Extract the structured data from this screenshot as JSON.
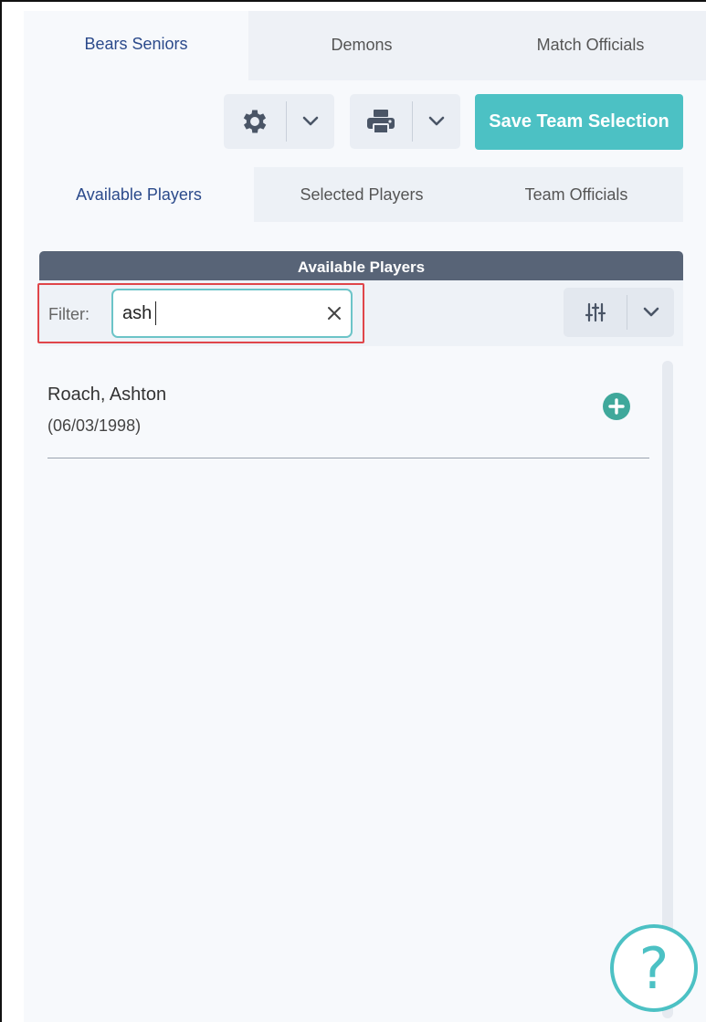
{
  "team_tabs": [
    {
      "label": "Bears Seniors",
      "active": true
    },
    {
      "label": "Demons",
      "active": false
    },
    {
      "label": "Match Officials",
      "active": false
    }
  ],
  "toolbar": {
    "settings_icon": "gear-icon",
    "print_icon": "printer-icon",
    "dropdown_icon": "chevron-down-icon",
    "save_label": "Save Team Selection"
  },
  "sub_tabs": [
    {
      "label": "Available Players",
      "active": true
    },
    {
      "label": "Selected Players",
      "active": false
    },
    {
      "label": "Team Officials",
      "active": false
    }
  ],
  "list": {
    "header": "Available Players",
    "filter_label": "Filter:",
    "filter_value": "ash",
    "columns_icon": "sliders-icon"
  },
  "players": [
    {
      "name": "Roach, Ashton",
      "dob": "(06/03/1998)"
    }
  ],
  "help": {
    "label": "?"
  },
  "colors": {
    "accent": "#4cc1c4",
    "header_bg": "#586477",
    "active_tab_text": "#2b4a8b",
    "highlight": "#e0464a"
  }
}
